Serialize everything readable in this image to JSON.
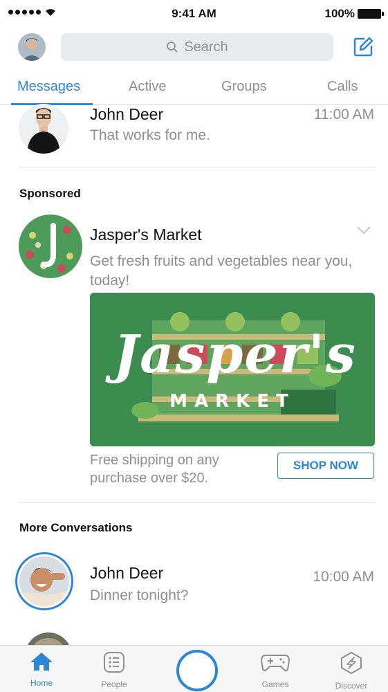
{
  "status_bar": {
    "time": "9:41 AM",
    "battery": "100%"
  },
  "header": {
    "search_placeholder": "Search"
  },
  "tabs": [
    {
      "label": "Messages",
      "active": true
    },
    {
      "label": "Active",
      "active": false
    },
    {
      "label": "Groups",
      "active": false
    },
    {
      "label": "Calls",
      "active": false
    }
  ],
  "conversations_top": [
    {
      "name": "John Deer",
      "time": "11:00 AM",
      "preview": "That works for me."
    }
  ],
  "sponsored": {
    "section_title": "Sponsored",
    "advertiser": "Jasper's Market",
    "description": "Get fresh fruits and vegetables near you, today!",
    "image_title": "Jasper's",
    "image_subtitle": "MARKET",
    "footer_text": "Free shipping on any purchase over $20.",
    "cta": "SHOP NOW"
  },
  "more_conversations": {
    "section_title": "More Conversations",
    "items": [
      {
        "name": "John Deer",
        "time": "10:00 AM",
        "preview": "Dinner tonight?"
      }
    ]
  },
  "bottom_nav": [
    {
      "label": "Home",
      "icon": "home-icon",
      "active": true
    },
    {
      "label": "People",
      "icon": "people-list-icon",
      "active": false
    },
    {
      "label": "",
      "icon": "camera-shutter-icon",
      "active": false
    },
    {
      "label": "Games",
      "icon": "gamepad-icon",
      "active": false
    },
    {
      "label": "Discover",
      "icon": "compass-icon",
      "active": false
    }
  ],
  "colors": {
    "accent": "#2b86d6",
    "ad_green": "#3d8c4f",
    "muted_text": "#8e8e93"
  }
}
